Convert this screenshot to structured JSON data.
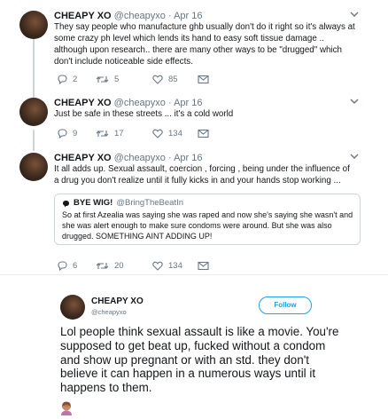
{
  "tweets": [
    {
      "name": "CHEAPY XO",
      "handle": "@cheapyxo · Apr 16",
      "text": "They say people who manufacture ghb usually don't do it right so it's always at some crazy ph level which lends its hand to easy soft tissue damage .. although upon research.. there are many other ways to be \"drugged\" which don't include noticeable side effects.",
      "replies": "2",
      "retweets": "5",
      "likes": "85"
    },
    {
      "name": "CHEAPY XO",
      "handle": "@cheapyxo · Apr 16",
      "text": "Just be safe in these streets ... it's a cold world",
      "replies": "9",
      "retweets": "17",
      "likes": "134"
    },
    {
      "name": "CHEAPY XO",
      "handle": "@cheapyxo · Apr 16",
      "text": "It all adds up. Sexual assault, coercion , forcing , being under the influence of a drug you don't realize until it fully kicks in and your hands stop working ...",
      "replies": "6",
      "retweets": "20",
      "likes": "134",
      "quote": {
        "name": "BYE WIG!",
        "handle": "@BringTheBeatIn",
        "text": "So at first Azealia was saying she was raped and now she's saying she wasn't and she was alert enough to make sure condoms were around. But she was also drugged. SOMETHING AINT ADDING UP!"
      }
    }
  ],
  "embed": {
    "name": "CHEAPY XO",
    "handle": "@cheapyxo",
    "follow_label": "Follow",
    "text": "Lol people think sexual assault is like a movie. You're supposed to get beat up, fucked without a condom and show up pregnant or with an std. they don't believe it can happen in a numerous ways until it happens to them."
  },
  "colors": {
    "accent": "#1da1f2",
    "muted": "#657786",
    "border": "#ccd6dd"
  },
  "icons": [
    "reply-icon",
    "retweet-icon",
    "like-icon",
    "message-icon",
    "chevron-down-icon",
    "facepalm-emoji-icon"
  ]
}
